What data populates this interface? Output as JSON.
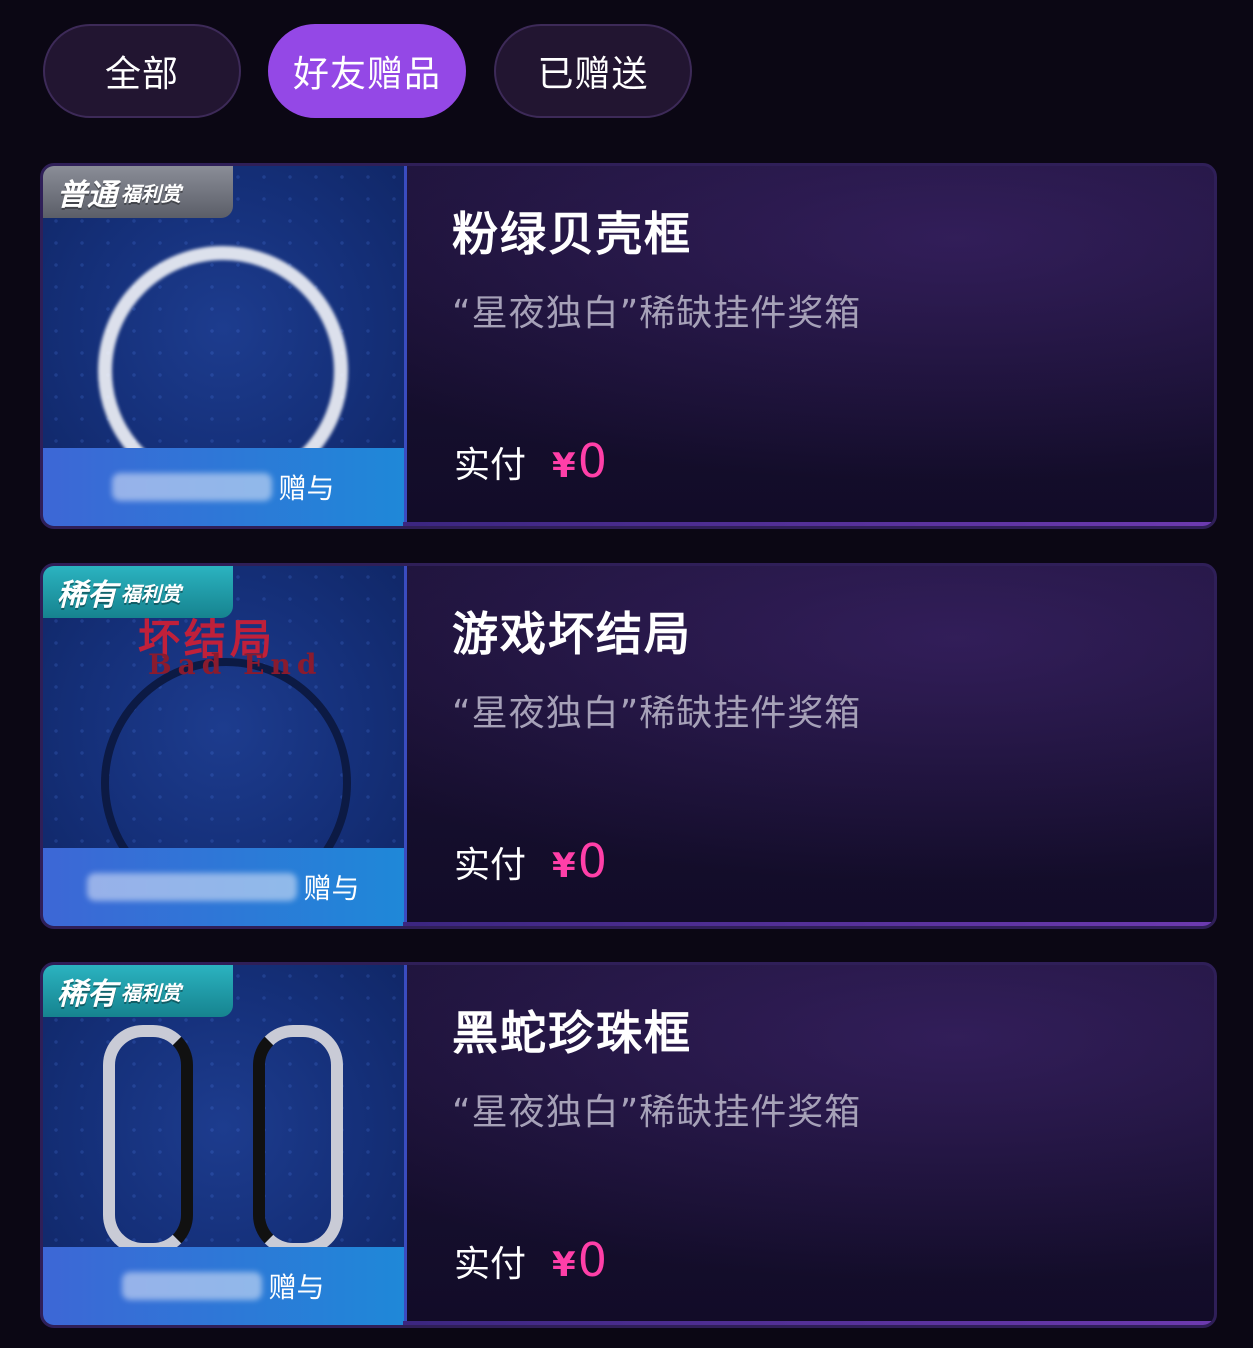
{
  "tabs": [
    {
      "label": "全部",
      "active": false
    },
    {
      "label": "好友赠品",
      "active": true
    },
    {
      "label": "已赠送",
      "active": false
    }
  ],
  "gifts": [
    {
      "badge_main": "普通",
      "badge_sub": "福利赏",
      "title": "粉绿贝壳框",
      "subtitle": "“星夜独白”稀缺挂件奖箱",
      "price_label": "实付",
      "currency": "¥",
      "amount": "0",
      "gift_suffix": "赠与",
      "art": "white-glow-ring-icon"
    },
    {
      "badge_main": "稀有",
      "badge_sub": "福利赏",
      "title": "游戏坏结局",
      "subtitle": "“星夜独白”稀缺挂件奖箱",
      "price_label": "实付",
      "currency": "¥",
      "amount": "0",
      "gift_suffix": "赠与",
      "art_text": "坏结局",
      "art_sub": "Bad End"
    },
    {
      "badge_main": "稀有",
      "badge_sub": "福利赏",
      "title": "黑蛇珍珠框",
      "subtitle": "“星夜独白”稀缺挂件奖箱",
      "price_label": "实付",
      "currency": "¥",
      "amount": "0",
      "gift_suffix": "赠与",
      "art": "black-snake-pearl-frame-icon"
    }
  ],
  "colors": {
    "accent": "#9448e6",
    "price": "#ff3fa8",
    "common_badge": "#6f727c",
    "rare_badge": "#1f9ba8"
  }
}
